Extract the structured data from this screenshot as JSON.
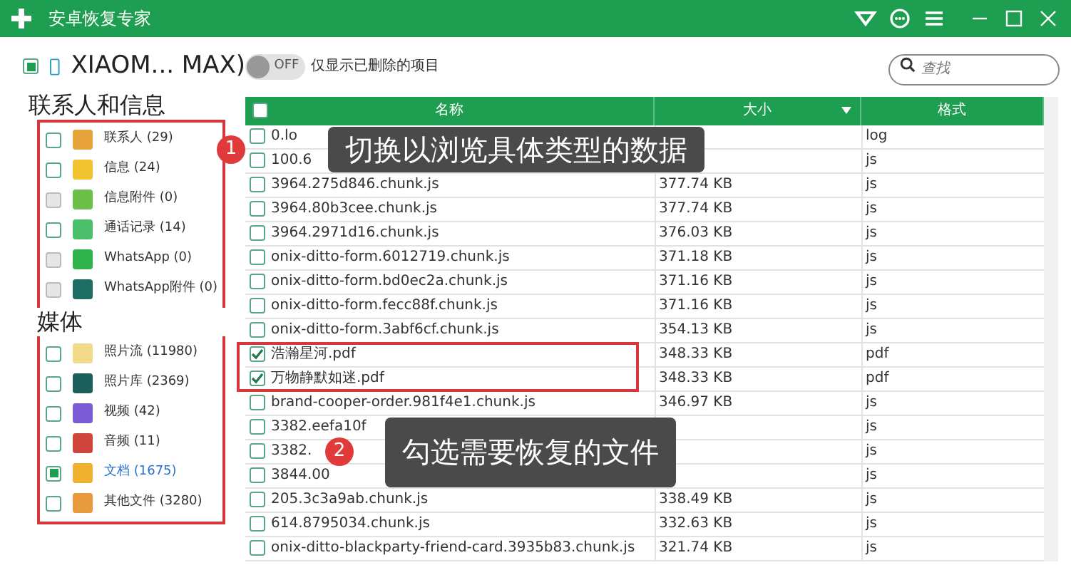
{
  "window": {
    "title": "安卓恢复专家"
  },
  "device": {
    "name": "XIAOM... MAX)",
    "checked": true
  },
  "filter_toggle": {
    "on": false,
    "state_label": "OFF",
    "label": "仅显示已删除的项目"
  },
  "search": {
    "placeholder": "查找"
  },
  "sections": [
    {
      "title": "联系人和信息",
      "items": [
        {
          "label": "联系人 (29)",
          "checked": false,
          "disabled": false,
          "selected": false,
          "color": "#e8a33d"
        },
        {
          "label": "信息 (24)",
          "checked": false,
          "disabled": false,
          "selected": false,
          "color": "#f2c12e"
        },
        {
          "label": "信息附件 (0)",
          "checked": false,
          "disabled": true,
          "selected": false,
          "color": "#6cc04a"
        },
        {
          "label": "通话记录 (14)",
          "checked": false,
          "disabled": false,
          "selected": false,
          "color": "#4cbf6b"
        },
        {
          "label": "WhatsApp (0)",
          "checked": false,
          "disabled": true,
          "selected": false,
          "color": "#2fb34a"
        },
        {
          "label": "WhatsApp附件 (0)",
          "checked": false,
          "disabled": true,
          "selected": false,
          "color": "#1f6e63"
        }
      ]
    },
    {
      "title": "媒体",
      "items": [
        {
          "label": "照片流 (11980)",
          "checked": false,
          "disabled": false,
          "selected": false,
          "color": "#f3d98a"
        },
        {
          "label": "照片库 (2369)",
          "checked": false,
          "disabled": false,
          "selected": false,
          "color": "#1b5e5a"
        },
        {
          "label": "视频 (42)",
          "checked": false,
          "disabled": false,
          "selected": false,
          "color": "#7c5cd6"
        },
        {
          "label": "音频 (11)",
          "checked": false,
          "disabled": false,
          "selected": false,
          "color": "#d0463c"
        },
        {
          "label": "文档 (1675)",
          "checked": true,
          "disabled": false,
          "selected": true,
          "color": "#f0b030"
        },
        {
          "label": "其他文件 (3280)",
          "checked": false,
          "disabled": false,
          "selected": false,
          "color": "#e89a3c"
        }
      ]
    }
  ],
  "table": {
    "all_checked": false,
    "columns": [
      "名称",
      "大小",
      "格式"
    ],
    "rows": [
      {
        "name": "0.lo",
        "format": "log",
        "checked": false
      },
      {
        "name": "100.6",
        "format": "js",
        "checked": false
      },
      {
        "name": "3964.275d846.chunk.js",
        "size": "377.74 KB",
        "format": "js",
        "checked": false
      },
      {
        "name": "3964.80b3cee.chunk.js",
        "size": "377.74 KB",
        "format": "js",
        "checked": false
      },
      {
        "name": "3964.2971d16.chunk.js",
        "size": "376.03 KB",
        "format": "js",
        "checked": false
      },
      {
        "name": "onix-ditto-form.6012719.chunk.js",
        "size": "371.18 KB",
        "format": "js",
        "checked": false
      },
      {
        "name": "onix-ditto-form.bd0ec2a.chunk.js",
        "size": "371.16 KB",
        "format": "js",
        "checked": false
      },
      {
        "name": "onix-ditto-form.fecc88f.chunk.js",
        "size": "371.16 KB",
        "format": "js",
        "checked": false
      },
      {
        "name": "onix-ditto-form.3abf6cf.chunk.js",
        "size": "354.13 KB",
        "format": "js",
        "checked": false
      },
      {
        "name": "浩瀚星河.pdf",
        "size": "348.33 KB",
        "format": "pdf",
        "checked": true
      },
      {
        "name": "万物静默如迷.pdf",
        "size": "348.33 KB",
        "format": "pdf",
        "checked": true
      },
      {
        "name": "brand-cooper-order.981f4e1.chunk.js",
        "size": "346.97 KB",
        "format": "js",
        "checked": false
      },
      {
        "name": "3382.eefa10f",
        "format": "js",
        "checked": false
      },
      {
        "name": "3382.",
        "format": "js",
        "checked": false
      },
      {
        "name": "3844.00",
        "format": "js",
        "checked": false
      },
      {
        "name": "205.3c3a9ab.chunk.js",
        "size": "338.49 KB",
        "format": "js",
        "checked": false
      },
      {
        "name": "614.8795034.chunk.js",
        "size": "332.63 KB",
        "format": "js",
        "checked": false
      },
      {
        "name": "onix-ditto-blackparty-friend-card.3935b83.chunk.js",
        "size": "321.74 KB",
        "format": "js",
        "checked": false
      }
    ]
  },
  "callouts": [
    {
      "number": "1",
      "text": "切换以浏览具体类型的数据"
    },
    {
      "number": "2",
      "text": "勾选需要恢复的文件"
    }
  ]
}
